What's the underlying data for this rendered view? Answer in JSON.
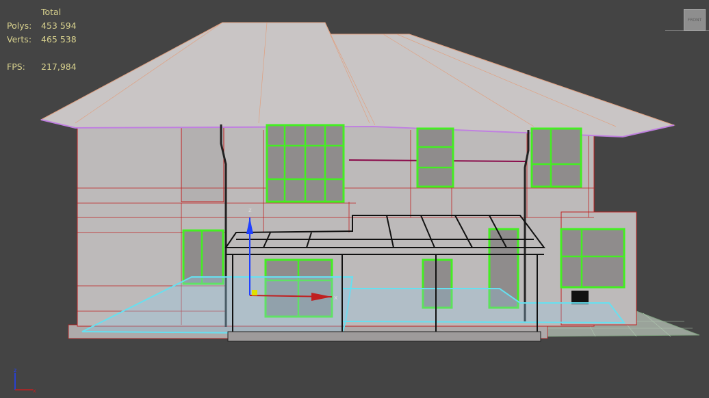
{
  "stats": {
    "header": "Total",
    "polys_label": "Polys:",
    "polys_value": "453 594",
    "verts_label": "Verts:",
    "verts_value": "465 538",
    "fps_label": "FPS:",
    "fps_value": "217,984"
  },
  "viewcube": {
    "face_label": "FRONT"
  },
  "colors": {
    "background": "#444444",
    "stats_text": "#d9d28e",
    "selection_green": "#44ee22",
    "edges_red": "#c02020",
    "ground_cyan": "#66e0f0"
  },
  "icons": [
    "viewcube-icon",
    "transform-gizmo-icon",
    "world-axis-icon"
  ]
}
